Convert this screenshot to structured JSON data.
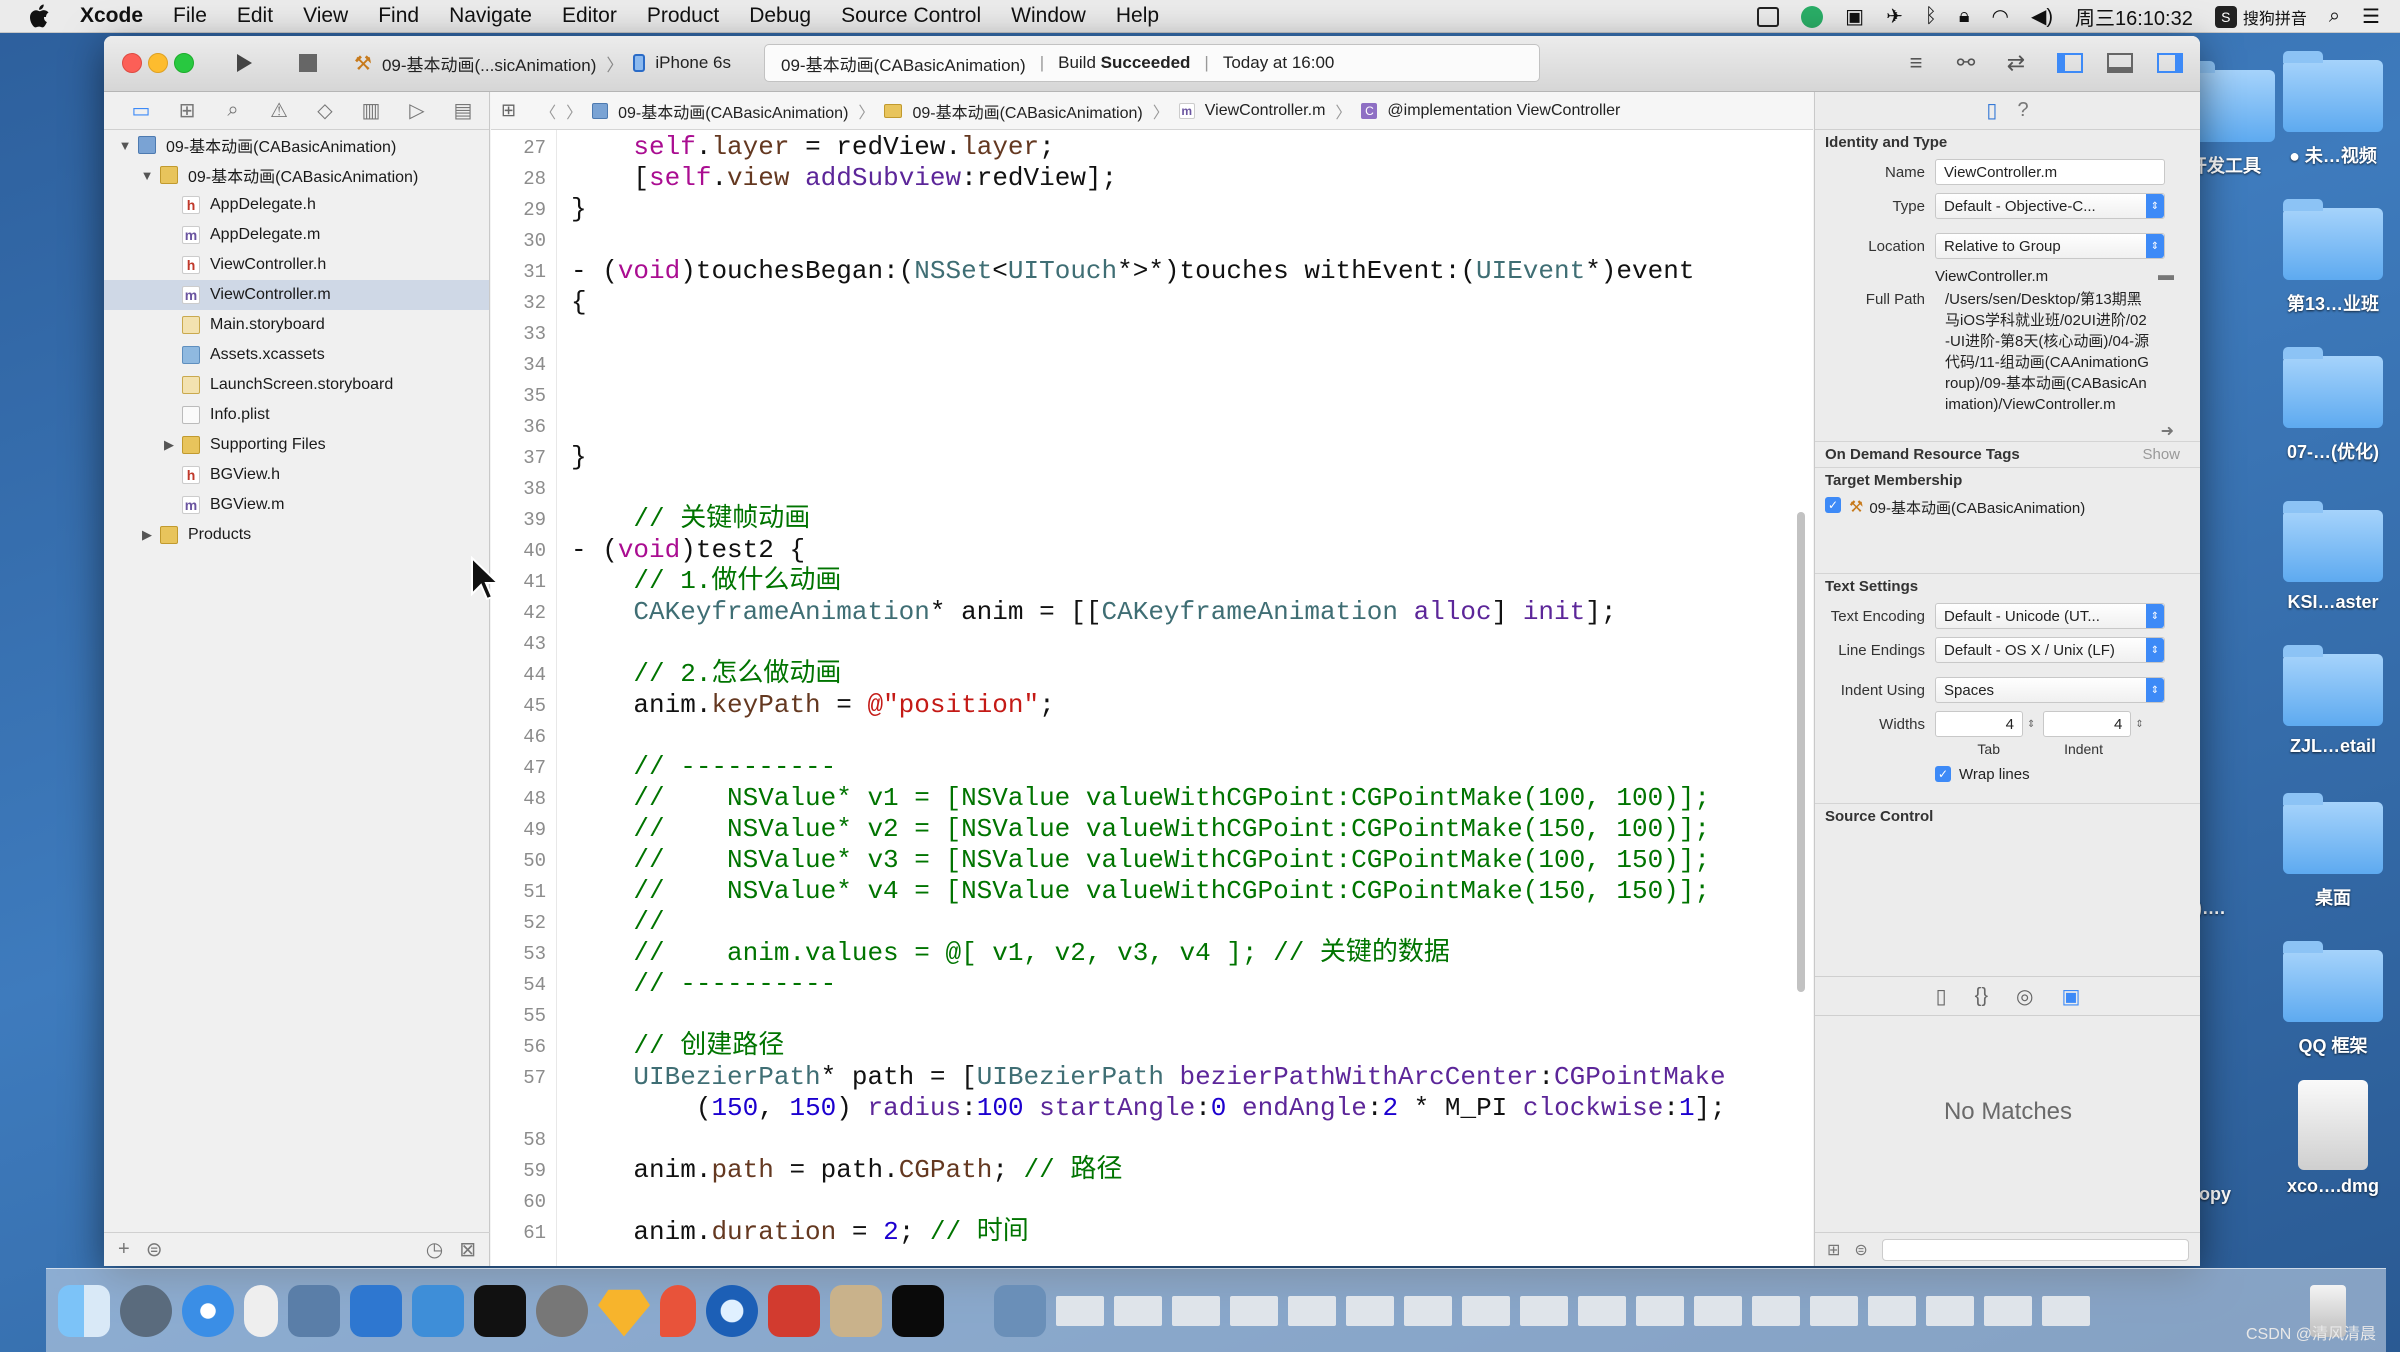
{
  "menubar": {
    "app": "Xcode",
    "items": [
      "File",
      "Edit",
      "View",
      "Find",
      "Navigate",
      "Editor",
      "Product",
      "Debug",
      "Source Control",
      "Window",
      "Help"
    ],
    "clock": "周三16:10:32",
    "input_method": "搜狗拼音"
  },
  "toolbar": {
    "scheme": "09-基本动画(...sicAnimation)",
    "device": "iPhone 6s",
    "activity_project": "09-基本动画(CABasicAnimation)",
    "build_label": "Build",
    "build_status": "Succeeded",
    "build_time": "Today at 16:00"
  },
  "navigator": {
    "items": [
      {
        "label": "09-基本动画(CABasicAnimation)",
        "type": "proj",
        "indent": 0,
        "disc": "▼"
      },
      {
        "label": "09-基本动画(CABasicAnimation)",
        "type": "fd",
        "indent": 1,
        "disc": "▼"
      },
      {
        "label": "AppDelegate.h",
        "type": "h",
        "indent": 2
      },
      {
        "label": "AppDelegate.m",
        "type": "m",
        "indent": 2
      },
      {
        "label": "ViewController.h",
        "type": "h",
        "indent": 2
      },
      {
        "label": "ViewController.m",
        "type": "m",
        "indent": 2,
        "selected": true
      },
      {
        "label": "Main.storyboard",
        "type": "sb",
        "indent": 2
      },
      {
        "label": "Assets.xcassets",
        "type": "as",
        "indent": 2
      },
      {
        "label": "LaunchScreen.storyboard",
        "type": "sb",
        "indent": 2
      },
      {
        "label": "Info.plist",
        "type": "pl",
        "indent": 2
      },
      {
        "label": "Supporting Files",
        "type": "fd",
        "indent": 2,
        "disc": "▶"
      },
      {
        "label": "BGView.h",
        "type": "h",
        "indent": 2
      },
      {
        "label": "BGView.m",
        "type": "m",
        "indent": 2
      },
      {
        "label": "Products",
        "type": "fd",
        "indent": 1,
        "disc": "▶"
      }
    ]
  },
  "jumpbar": {
    "crumbs": [
      "09-基本动画(CABasicAnimation)",
      "09-基本动画(CABasicAnimation)",
      "ViewController.m",
      "@implementation ViewController"
    ]
  },
  "editor": {
    "lines": [
      {
        "n": "27",
        "tokens": [
          [
            "",
            "    "
          ],
          [
            "k",
            "self"
          ],
          [
            "",
            "."
          ],
          [
            "p",
            "layer"
          ],
          [
            "",
            " = redView."
          ],
          [
            "p",
            "layer"
          ],
          [
            "",
            ";"
          ]
        ]
      },
      {
        "n": "28",
        "tokens": [
          [
            "",
            "    ["
          ],
          [
            "k",
            "self"
          ],
          [
            "",
            "."
          ],
          [
            "p",
            "view"
          ],
          [
            "",
            " "
          ],
          [
            "tc",
            "addSubview"
          ],
          [
            "",
            ":redView];"
          ]
        ]
      },
      {
        "n": "29",
        "tokens": [
          [
            "",
            "}"
          ]
        ]
      },
      {
        "n": "30",
        "tokens": []
      },
      {
        "n": "31",
        "tokens": [
          [
            "",
            "- ("
          ],
          [
            "k",
            "void"
          ],
          [
            "",
            ")touchesBegan:("
          ],
          [
            "t",
            "NSSet"
          ],
          [
            "",
            "<"
          ],
          [
            "t",
            "UITouch"
          ],
          [
            "",
            "*>*)touches withEvent:("
          ],
          [
            "t",
            "UIEvent"
          ],
          [
            "",
            "*)event"
          ]
        ]
      },
      {
        "n": "32",
        "tokens": [
          [
            "",
            "{"
          ]
        ]
      },
      {
        "n": "33",
        "tokens": []
      },
      {
        "n": "34",
        "tokens": []
      },
      {
        "n": "35",
        "tokens": []
      },
      {
        "n": "36",
        "tokens": []
      },
      {
        "n": "37",
        "tokens": [
          [
            "",
            "}"
          ]
        ]
      },
      {
        "n": "38",
        "tokens": []
      },
      {
        "n": "39",
        "tokens": [
          [
            "c",
            "    // 关键帧动画"
          ]
        ]
      },
      {
        "n": "40",
        "tokens": [
          [
            "",
            "- ("
          ],
          [
            "k",
            "void"
          ],
          [
            "",
            ")test2 {"
          ]
        ]
      },
      {
        "n": "41",
        "tokens": [
          [
            "c",
            "    // 1.做什么动画"
          ]
        ]
      },
      {
        "n": "42",
        "tokens": [
          [
            "",
            "    "
          ],
          [
            "t",
            "CAKeyframeAnimation"
          ],
          [
            "",
            "* anim = [["
          ],
          [
            "t",
            "CAKeyframeAnimation"
          ],
          [
            "",
            " "
          ],
          [
            "tc",
            "alloc"
          ],
          [
            "",
            "] "
          ],
          [
            "tc",
            "init"
          ],
          [
            "",
            "];"
          ]
        ]
      },
      {
        "n": "43",
        "tokens": []
      },
      {
        "n": "44",
        "tokens": [
          [
            "c",
            "    // 2.怎么做动画"
          ]
        ]
      },
      {
        "n": "45",
        "tokens": [
          [
            "",
            "    anim."
          ],
          [
            "p",
            "keyPath"
          ],
          [
            "",
            " = "
          ],
          [
            "s",
            "@\"position\""
          ],
          [
            "",
            ";"
          ]
        ]
      },
      {
        "n": "46",
        "tokens": []
      },
      {
        "n": "47",
        "tokens": [
          [
            "c",
            "    // ----------"
          ]
        ]
      },
      {
        "n": "48",
        "tokens": [
          [
            "c",
            "    //    NSValue* v1 = [NSValue valueWithCGPoint:CGPointMake(100, 100)];"
          ]
        ]
      },
      {
        "n": "49",
        "tokens": [
          [
            "c",
            "    //    NSValue* v2 = [NSValue valueWithCGPoint:CGPointMake(150, 100)];"
          ]
        ]
      },
      {
        "n": "50",
        "tokens": [
          [
            "c",
            "    //    NSValue* v3 = [NSValue valueWithCGPoint:CGPointMake(100, 150)];"
          ]
        ]
      },
      {
        "n": "51",
        "tokens": [
          [
            "c",
            "    //    NSValue* v4 = [NSValue valueWithCGPoint:CGPointMake(150, 150)];"
          ]
        ]
      },
      {
        "n": "52",
        "tokens": [
          [
            "c",
            "    //"
          ]
        ]
      },
      {
        "n": "53",
        "tokens": [
          [
            "c",
            "    //    anim.values = @[ v1, v2, v3, v4 ]; // 关键的数据"
          ]
        ]
      },
      {
        "n": "54",
        "tokens": [
          [
            "c",
            "    // ----------"
          ]
        ]
      },
      {
        "n": "55",
        "tokens": []
      },
      {
        "n": "56",
        "tokens": [
          [
            "c",
            "    // 创建路径"
          ]
        ]
      },
      {
        "n": "57",
        "tokens": [
          [
            "",
            "    "
          ],
          [
            "t",
            "UIBezierPath"
          ],
          [
            "",
            "* path = ["
          ],
          [
            "t",
            "UIBezierPath"
          ],
          [
            "",
            " "
          ],
          [
            "tc",
            "bezierPathWithArcCenter"
          ],
          [
            "",
            ":"
          ],
          [
            "tc",
            "CGPointMake"
          ]
        ]
      },
      {
        "n": "",
        "tokens": [
          [
            "",
            "        ("
          ],
          [
            "n",
            "150"
          ],
          [
            "",
            ", "
          ],
          [
            "n",
            "150"
          ],
          [
            "",
            ") "
          ],
          [
            "tc",
            "radius"
          ],
          [
            "",
            ":"
          ],
          [
            "n",
            "100"
          ],
          [
            "",
            " "
          ],
          [
            "tc",
            "startAngle"
          ],
          [
            "",
            ":"
          ],
          [
            "n",
            "0"
          ],
          [
            "",
            " "
          ],
          [
            "tc",
            "endAngle"
          ],
          [
            "",
            ":"
          ],
          [
            "n",
            "2"
          ],
          [
            "",
            " * M_PI "
          ],
          [
            "tc",
            "clockwise"
          ],
          [
            "",
            ":"
          ],
          [
            "n",
            "1"
          ],
          [
            "",
            "];"
          ]
        ]
      },
      {
        "n": "58",
        "tokens": []
      },
      {
        "n": "59",
        "tokens": [
          [
            "",
            "    anim."
          ],
          [
            "p",
            "path"
          ],
          [
            "",
            " = path."
          ],
          [
            "p",
            "CGPath"
          ],
          [
            "",
            "; "
          ],
          [
            "c",
            "// 路径"
          ]
        ]
      },
      {
        "n": "60",
        "tokens": []
      },
      {
        "n": "61",
        "tokens": [
          [
            "",
            "    anim."
          ],
          [
            "p",
            "duration"
          ],
          [
            "",
            " = "
          ],
          [
            "n",
            "2"
          ],
          [
            "",
            "; "
          ],
          [
            "c",
            "// 时间"
          ]
        ]
      }
    ]
  },
  "inspector": {
    "identity_title": "Identity and Type",
    "name_label": "Name",
    "name_value": "ViewController.m",
    "type_label": "Type",
    "type_value": "Default - Objective-C...",
    "location_label": "Location",
    "location_value": "Relative to Group",
    "location_file": "ViewController.m",
    "fullpath_label": "Full Path",
    "fullpath_value": "/Users/sen/Desktop/第13期黑马iOS学科就业班/02UI进阶/02-UI进阶-第8天(核心动画)/04-源代码/11-组动画(CAAnimationGroup)/09-基本动画(CABasicAnimation)/ViewController.m",
    "odr_title": "On Demand Resource Tags",
    "odr_show": "Show",
    "target_title": "Target Membership",
    "target_item": "09-基本动画(CABasicAnimation)",
    "text_title": "Text Settings",
    "encoding_label": "Text Encoding",
    "encoding_value": "Default - Unicode (UT...",
    "endings_label": "Line Endings",
    "endings_value": "Default - OS X / Unix (LF)",
    "indent_label": "Indent Using",
    "indent_value": "Spaces",
    "widths_label": "Widths",
    "tab_value": "4",
    "indent_width_value": "4",
    "tab_caption": "Tab",
    "indent_caption": "Indent",
    "wrap_label": "Wrap lines",
    "source_title": "Source Control",
    "no_matches": "No Matches"
  },
  "desktop": {
    "icons": [
      {
        "label": "开发工具"
      },
      {
        "label": "● 未…视频"
      },
      {
        "label": "第13…业班"
      },
      {
        "label": "07-…(优化)"
      },
      {
        "label": "KSI…aster"
      },
      {
        "label": "ZJL…etail"
      },
      {
        "label": "桌面"
      },
      {
        "label": "QQ 框架"
      },
      {
        "label": "xco….dmg"
      },
      {
        "label": "n)…."
      },
      {
        "label": "opy"
      }
    ]
  },
  "watermark": "CSDN @清风清晨",
  "colors": {
    "accent": "#3d8af7",
    "selection": "#cfd8e6",
    "comment": "#007400",
    "keyword": "#aa0d91",
    "string": "#c41a16"
  }
}
